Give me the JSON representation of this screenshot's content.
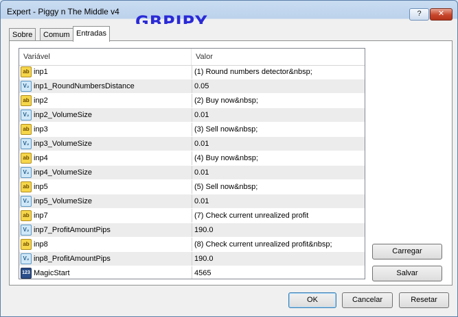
{
  "window": {
    "title": "Expert - Piggy n The Middle v4",
    "overlay_label": "GBPJPY",
    "help_label": "?",
    "close_label": "✕"
  },
  "tabs": [
    {
      "label": "Sobre",
      "active": false
    },
    {
      "label": "Comum",
      "active": false
    },
    {
      "label": "Entradas",
      "active": true
    }
  ],
  "grid": {
    "columns": [
      "Variável",
      "Valor"
    ],
    "rows": [
      {
        "icon": "ab",
        "name": "inp1",
        "value": "(1) Round numbers detector&nbsp;"
      },
      {
        "icon": "v2",
        "name": "inp1_RoundNumbersDistance",
        "value": "0.05"
      },
      {
        "icon": "ab",
        "name": "inp2",
        "value": "(2) Buy now&nbsp;"
      },
      {
        "icon": "v2",
        "name": "inp2_VolumeSize",
        "value": "0.01"
      },
      {
        "icon": "ab",
        "name": "inp3",
        "value": "(3) Sell now&nbsp;"
      },
      {
        "icon": "v2",
        "name": "inp3_VolumeSize",
        "value": "0.01"
      },
      {
        "icon": "ab",
        "name": "inp4",
        "value": "(4) Buy now&nbsp;"
      },
      {
        "icon": "v2",
        "name": "inp4_VolumeSize",
        "value": "0.01"
      },
      {
        "icon": "ab",
        "name": "inp5",
        "value": "(5) Sell now&nbsp;"
      },
      {
        "icon": "v2",
        "name": "inp5_VolumeSize",
        "value": "0.01"
      },
      {
        "icon": "ab",
        "name": "inp7",
        "value": "(7) Check current unrealized profit"
      },
      {
        "icon": "v2",
        "name": "inp7_ProfitAmountPips",
        "value": "190.0"
      },
      {
        "icon": "ab",
        "name": "inp8",
        "value": "(8) Check current unrealized profit&nbsp;"
      },
      {
        "icon": "v2",
        "name": "inp8_ProfitAmountPips",
        "value": "190.0"
      },
      {
        "icon": "123",
        "name": "MagicStart",
        "value": "4565"
      }
    ]
  },
  "icon_glyphs": {
    "ab": "ab",
    "v2": "V₂",
    "123": "123"
  },
  "side_buttons": {
    "load": "Carregar",
    "save": "Salvar"
  },
  "footer_buttons": {
    "ok": "OK",
    "cancel": "Cancelar",
    "reset": "Resetar"
  }
}
